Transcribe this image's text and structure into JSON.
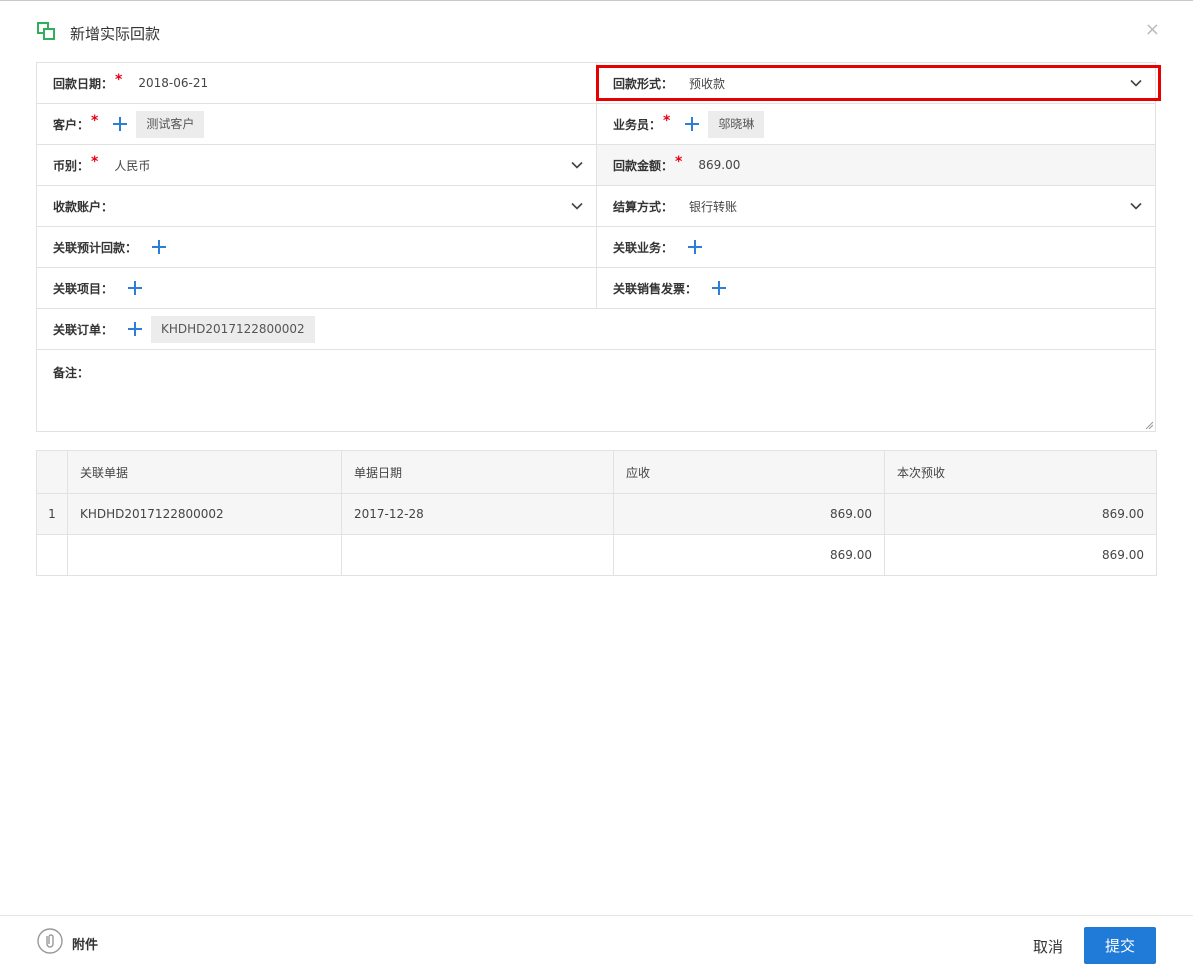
{
  "dialog": {
    "title": "新增实际回款",
    "close_symbol": "×"
  },
  "form": {
    "payment_date": {
      "label": "回款日期：",
      "required": "*",
      "value": "2018-06-21"
    },
    "payment_form": {
      "label": "回款形式：",
      "value": "预收款"
    },
    "customer": {
      "label": "客户：",
      "required": "*",
      "tag": "测试客户"
    },
    "salesperson": {
      "label": "业务员：",
      "required": "*",
      "tag": "邬晓琳"
    },
    "currency": {
      "label": "币别：",
      "required": "*",
      "value": "人民币"
    },
    "amount": {
      "label": "回款金额：",
      "required": "*",
      "value": "869.00"
    },
    "account": {
      "label": "收款账户：",
      "value": ""
    },
    "settlement": {
      "label": "结算方式：",
      "value": "银行转账"
    },
    "linked_forecast": {
      "label": "关联预计回款："
    },
    "linked_business": {
      "label": "关联业务："
    },
    "linked_project": {
      "label": "关联项目："
    },
    "linked_invoice": {
      "label": "关联销售发票："
    },
    "linked_order": {
      "label": "关联订单：",
      "tag": "KHDHD2017122800002"
    },
    "remark": {
      "label": "备注：",
      "value": ""
    }
  },
  "table": {
    "headers": [
      "",
      "关联单据",
      "单据日期",
      "应收",
      "本次预收"
    ],
    "rows": [
      {
        "index": "1",
        "doc": "KHDHD2017122800002",
        "date": "2017-12-28",
        "receivable": "869.00",
        "prepay": "869.00"
      }
    ],
    "total": {
      "receivable": "869.00",
      "prepay": "869.00"
    }
  },
  "footer": {
    "attach_label": "附件",
    "cancel_label": "取消",
    "submit_label": "提交"
  },
  "colors": {
    "accent": "#1f7ad8",
    "required": "#e60012",
    "highlight": "#e60000",
    "title_icon": "#2fb05c"
  },
  "icons": {
    "title": "window-copy-icon",
    "close": "close-icon",
    "dropdown": "chevron-down-icon",
    "add": "plus-icon",
    "attach": "paperclip-icon"
  }
}
